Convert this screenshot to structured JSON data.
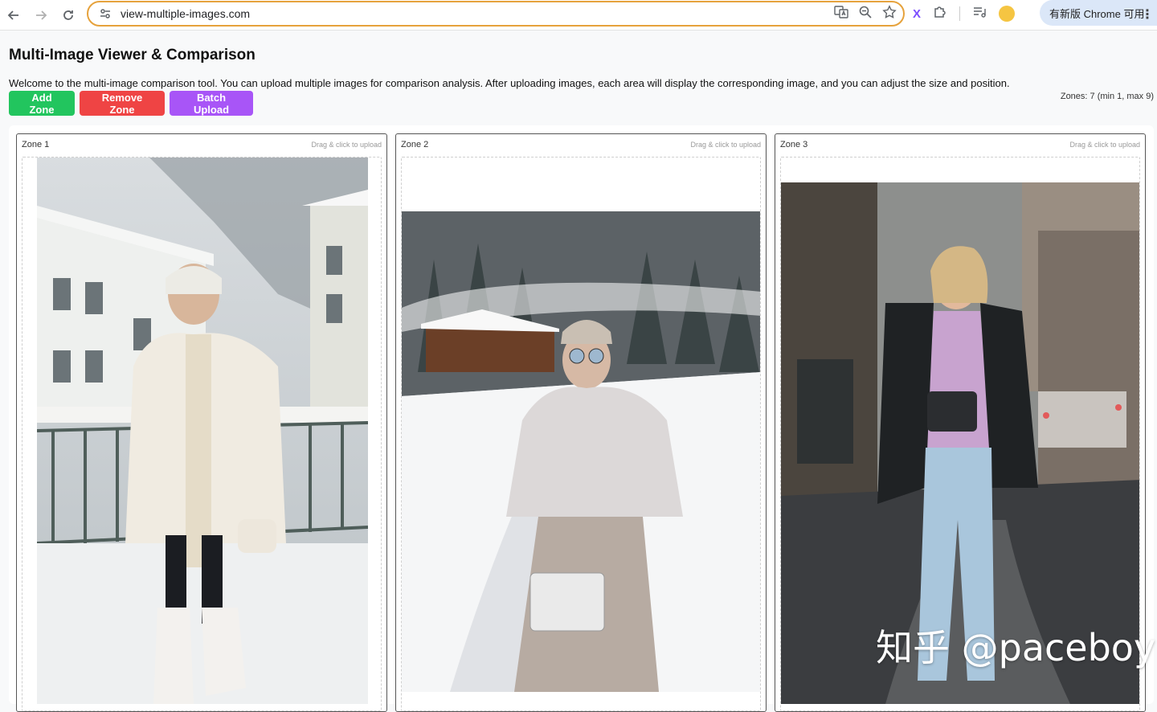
{
  "browser": {
    "url": "view-multiple-images.com",
    "update_label": "有新版 Chrome 可用"
  },
  "page": {
    "title": "Multi-Image Viewer & Comparison",
    "welcome": "Welcome to the multi-image comparison tool. You can upload multiple images for comparison analysis. After uploading images, each area will display the corresponding image, and you can adjust the size and position.",
    "zones_info": "Zones: 7 (min 1, max 9)"
  },
  "toolbar": {
    "add_label": "Add Zone",
    "remove_label": "Remove Zone",
    "batch_label": "Batch Upload"
  },
  "colors": {
    "add": "#22c55e",
    "remove": "#ef4444",
    "batch": "#a855f7",
    "omnibox_border": "#e6a23c"
  },
  "zones": [
    {
      "title": "Zone 1",
      "hint": "Drag & click to upload"
    },
    {
      "title": "Zone 2",
      "hint": "Drag & click to upload"
    },
    {
      "title": "Zone 3",
      "hint": "Drag & click to upload"
    }
  ],
  "watermark": "知乎 @paceboy"
}
